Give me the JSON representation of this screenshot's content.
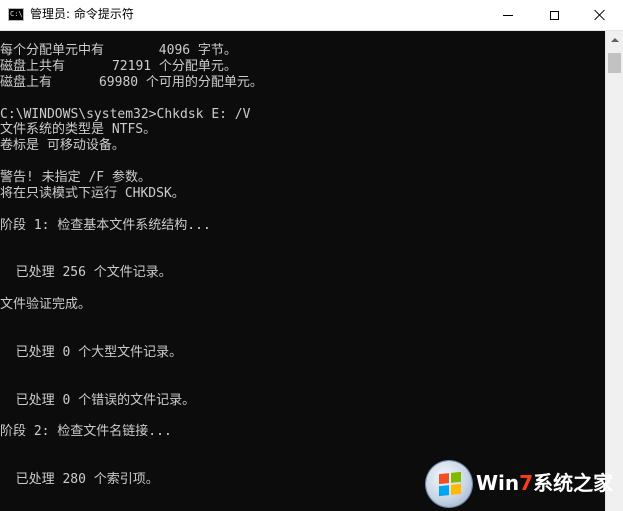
{
  "window": {
    "title": "管理员: 命令提示符",
    "icon_text": "C:\\",
    "caption_buttons": [
      "minimize-icon",
      "maximize-icon",
      "close-icon"
    ]
  },
  "console": {
    "background": "#0c0c0c",
    "foreground": "#cccccc",
    "lines": [
      "每个分配单元中有       4096 字节。",
      "磁盘上共有      72191 个分配单元。",
      "磁盘上有      69980 个可用的分配单元。",
      "",
      "C:\\WINDOWS\\system32>Chkdsk E: /V",
      "文件系统的类型是 NTFS。",
      "卷标是 可移动设备。",
      "",
      "警告! 未指定 /F 参数。",
      "将在只读模式下运行 CHKDSK。",
      "",
      "阶段 1: 检查基本文件系统结构...",
      "",
      "",
      "  已处理 256 个文件记录。",
      "",
      "文件验证完成。",
      "",
      "",
      "  已处理 0 个大型文件记录。",
      "",
      "",
      "  已处理 0 个错误的文件记录。",
      "",
      "阶段 2: 检查文件名链接...",
      "",
      "",
      "  已处理 280 个索引项。"
    ]
  },
  "watermark": {
    "brand_win": "Win",
    "brand_7": "7",
    "brand_site": "系统之家",
    "logo": "windows-flag-logo"
  }
}
